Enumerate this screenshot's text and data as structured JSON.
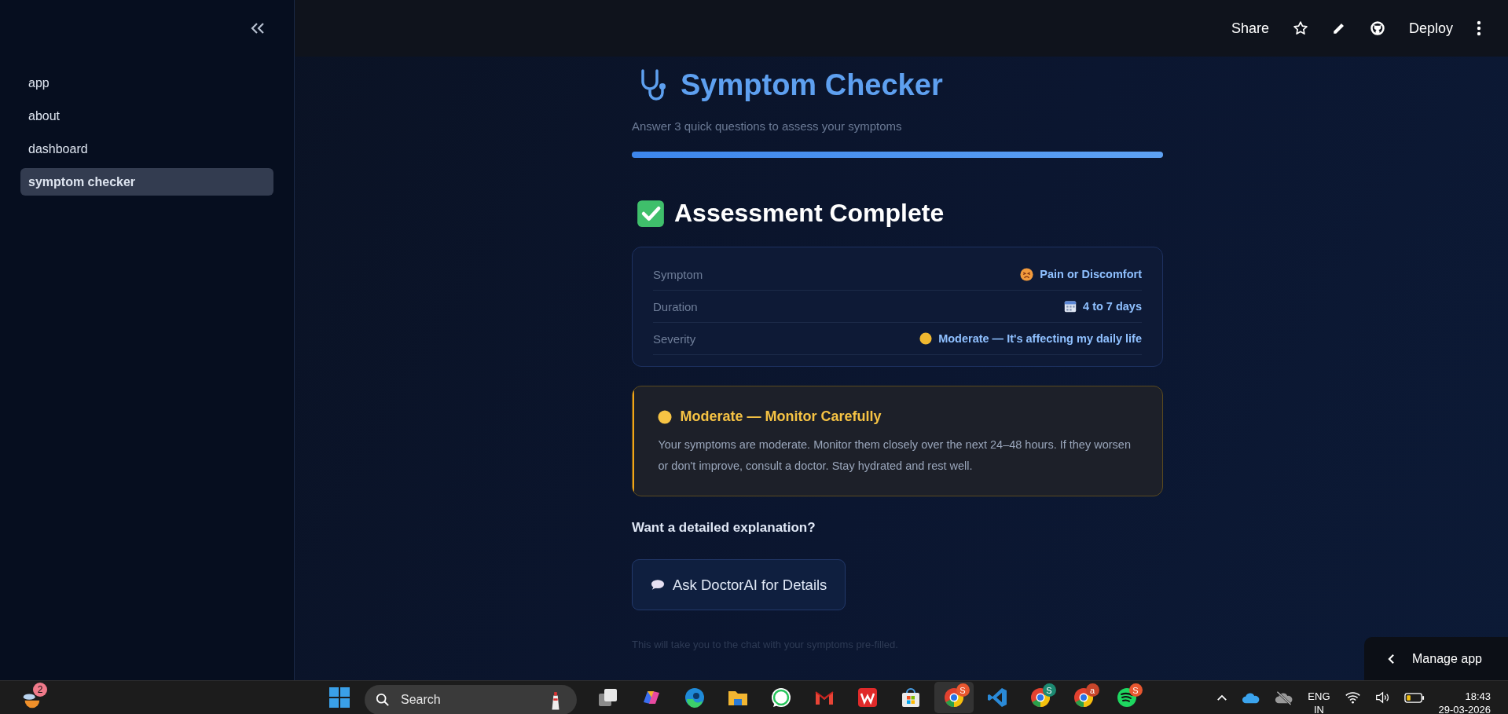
{
  "sidebar": {
    "items": [
      {
        "label": "app",
        "selected": false
      },
      {
        "label": "about",
        "selected": false
      },
      {
        "label": "dashboard",
        "selected": false
      },
      {
        "label": "symptom checker",
        "selected": true
      }
    ]
  },
  "header": {
    "actions": [
      {
        "kind": "text",
        "label": "Share"
      },
      {
        "kind": "star"
      },
      {
        "kind": "pencil"
      },
      {
        "kind": "github"
      },
      {
        "kind": "text",
        "label": "Deploy"
      },
      {
        "kind": "more"
      }
    ]
  },
  "page": {
    "title": "Symptom Checker",
    "subtitle": "Answer 3 quick questions to assess your symptoms",
    "progress": {
      "level": 1
    },
    "heading": "Assessment Complete",
    "summary": [
      {
        "label": "Symptom",
        "kind": "face",
        "value": "Pain or Discomfort"
      },
      {
        "label": "Duration",
        "kind": "calendar",
        "value": "4 to 7 days"
      },
      {
        "label": "Severity",
        "kind": "circle",
        "value": "Moderate — It's affecting my daily life"
      }
    ],
    "result": {
      "kind": "moderate",
      "title": "Moderate — Monitor Carefully",
      "text": "Your symptoms are moderate. Monitor them closely over the next 24–48 hours. If they worsen or don't improve, consult a doctor. Stay hydrated and rest well."
    },
    "prompt": "Want a detailed explanation?",
    "button": "Ask DoctorAI for Details",
    "note": "This will take you to the chat with your symptoms pre-filled."
  },
  "manage_app": "Manage app",
  "taskbar": {
    "weather_badge": "2",
    "search_placeholder": "Search",
    "apps": [
      {
        "kind": "taskview"
      },
      {
        "kind": "copilot"
      },
      {
        "kind": "edge"
      },
      {
        "kind": "files"
      },
      {
        "kind": "whatsapp"
      },
      {
        "kind": "gmail"
      },
      {
        "kind": "wps"
      },
      {
        "kind": "store"
      },
      {
        "kind": "chrome",
        "badge": "S",
        "color": "#e8572f",
        "selected": true
      },
      {
        "kind": "vscode"
      },
      {
        "kind": "chrome",
        "badge": "S",
        "color": "#1c8a72",
        "selected": false
      },
      {
        "kind": "chrome",
        "badge": "a",
        "color": "#c8452a",
        "selected": false
      },
      {
        "kind": "spotify",
        "badge": "S",
        "color": "#e8572f",
        "selected": false
      }
    ],
    "language": "ENG",
    "region": "IN",
    "time": "18:43",
    "date": "29-03-2026"
  }
}
